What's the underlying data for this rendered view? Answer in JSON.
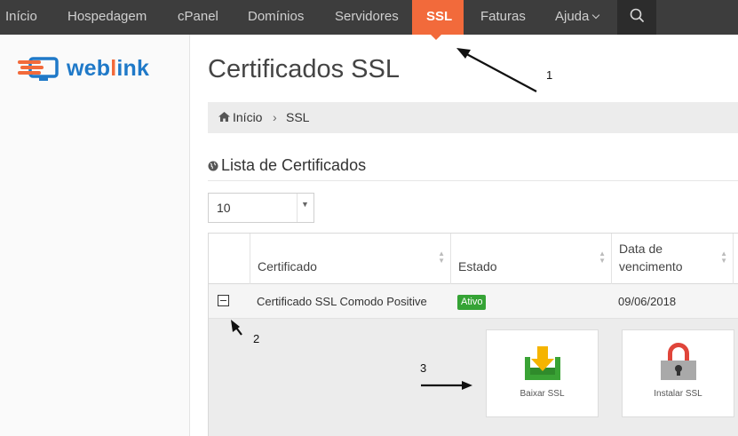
{
  "nav": {
    "items": [
      {
        "label": "Início"
      },
      {
        "label": "Hospedagem"
      },
      {
        "label": "cPanel"
      },
      {
        "label": "Domínios"
      },
      {
        "label": "Servidores"
      },
      {
        "label": "SSL"
      },
      {
        "label": "Faturas"
      },
      {
        "label": "Ajuda"
      }
    ],
    "active": "SSL",
    "search_icon": "search-icon"
  },
  "brand": {
    "name_prefix": "web",
    "name_highlight": "l",
    "name_suffix": "ink",
    "colors": {
      "blue": "#1f79c8",
      "orange": "#f26a3b"
    }
  },
  "page": {
    "title": "Certificados SSL"
  },
  "breadcrumb": {
    "home": "Início",
    "separator": "›",
    "current": "SSL"
  },
  "list": {
    "title": "Lista de Certificados",
    "page_size": "10",
    "columns": {
      "certificado": "Certificado",
      "estado": "Estado",
      "vencimento_line1": "Data de",
      "vencimento_line2": "vencimento"
    },
    "rows": [
      {
        "certificado": "Certificado SSL Comodo Positive",
        "estado": "Ativo",
        "vencimento": "09/06/2018"
      }
    ]
  },
  "actions": {
    "download_label": "Baixar SSL",
    "install_label": "Instalar SSL"
  },
  "annotations": {
    "one": "1",
    "two": "2",
    "three": "3"
  },
  "colors": {
    "accent": "#f26a3b",
    "nav_bg": "#3d3d3d",
    "status_active": "#35a335"
  }
}
